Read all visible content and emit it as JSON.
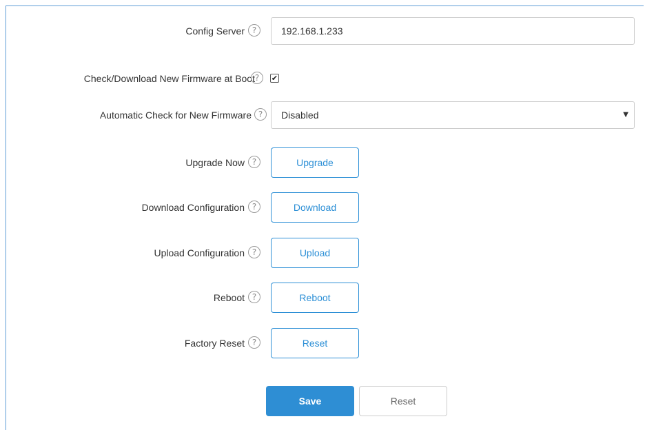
{
  "form": {
    "config_server": {
      "label": "Config Server",
      "value": "192.168.1.233"
    },
    "check_firmware_boot": {
      "label": "Check/Download New Firmware at Boot",
      "checked": true,
      "check_glyph": "✔"
    },
    "auto_check_firmware": {
      "label": "Automatic Check for New Firmware",
      "selected": "Disabled"
    },
    "upgrade_now": {
      "label": "Upgrade Now",
      "button": "Upgrade"
    },
    "download_config": {
      "label": "Download Configuration",
      "button": "Download"
    },
    "upload_config": {
      "label": "Upload Configuration",
      "button": "Upload"
    },
    "reboot": {
      "label": "Reboot",
      "button": "Reboot"
    },
    "factory_reset": {
      "label": "Factory Reset",
      "button": "Reset"
    }
  },
  "help_glyph": "?",
  "select_arrow": "▼",
  "footer": {
    "save": "Save",
    "reset": "Reset"
  },
  "colors": {
    "accent": "#2e8ed4",
    "frame_border": "#5b9bd5"
  }
}
